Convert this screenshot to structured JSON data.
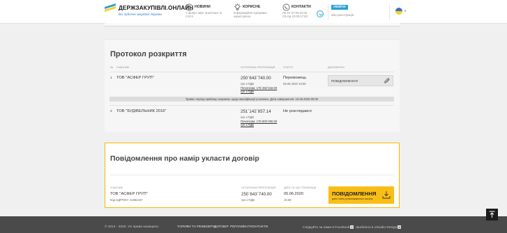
{
  "header": {
    "logo_title": "ДЕРЖЗАКУПІВЛІ.ОНЛАЙН",
    "logo_subtitle": "Всі публічні закупівлі України",
    "nav": [
      {
        "title": "НОВИНИ",
        "desc1": "У фокусі змін: аналітика та",
        "desc2": "статті"
      },
      {
        "title": "КОРИСНЕ",
        "desc1": "Інформаційна підтримка",
        "desc2": "користувача"
      },
      {
        "title": "КОНТАКТИ",
        "desc1": "Пн-Пт 07:00-22:00",
        "desc2": "Сб-Нд 10:00-17:00"
      }
    ],
    "login_label": "УВІЙТИ",
    "register_label": "або реєстрація",
    "lang_icon": "flag-ua-icon"
  },
  "protocol": {
    "title": "Протокол розкриття",
    "columns": [
      "№",
      "Учасник",
      "Остаточна пропозиція",
      "Статус",
      "Документи"
    ],
    "rows": [
      {
        "num": "1",
        "name": "ТОВ \"АСФЕР ГРУП\"",
        "amount": "250`643`740.00",
        "vat": "грн з ПДВ",
        "initial_line1": "Початкова: 175`450`618.00",
        "initial_line2": "грн з ПДВ",
        "status": "Переможець",
        "status_date": "05.06.2020 15:59",
        "doc_label": "ПОВІДОМЛЕННЯ"
      },
      {
        "num": "2",
        "name": "ТОВ \"БУДІВЕЛЬНИК 2016\"",
        "amount": "251`142`857.14",
        "vat": "грн з ПДВ",
        "initial_line1": "Початкова: 175`800`000.00",
        "initial_line2": "грн з ПДВ",
        "status": "Не розглядався"
      }
    ],
    "notice": "Триває період прийому скаржень щодо кваліфікації учасника. Дата завершення: 15.06.2020 00:00"
  },
  "intent": {
    "title": "Повідомлення про намір укласти договір",
    "col_participant": "Учасник",
    "col_offer": "Остаточна пропозиція",
    "col_date": "Дата та час публікації",
    "participant": "ТОВ \"АСФЕР ГРУП\"",
    "edrpou": "Код ЄДРПОУ: 41864437",
    "amount": "250`643`740.00",
    "vat": "грн з ПДВ",
    "date": "05.06.2020",
    "time": "15:59",
    "button_title": "ПОВІДОМЛЕННЯ",
    "button_sub": "дано тайту уповноваженого органу"
  },
  "footer": {
    "copyright": "© 2014 - 2020. Усі права захищено.",
    "links": [
      "ТАРИФИ ТА РЕКВІЗИТИ",
      "ДОГОВІР",
      "РЕГЛАМЕНТ",
      "КОНТАКТИ"
    ],
    "facebook": "Слідкуйте за нами в Facebook",
    "made_by": "Зроблено в uStudio Design"
  },
  "colors": {
    "accent": "#2a9fd8",
    "highlight": "#f9be16",
    "footer": "#4a4a4a"
  }
}
